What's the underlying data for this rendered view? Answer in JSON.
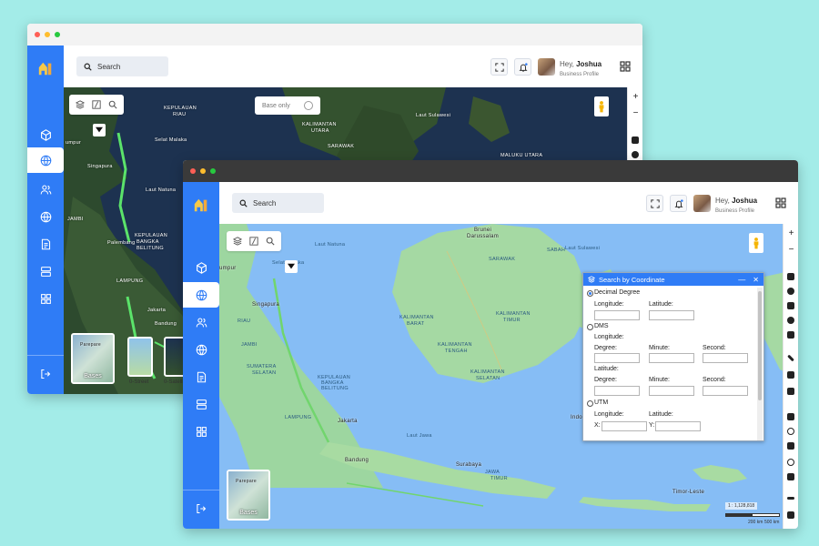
{
  "colors": {
    "background": "#a3ece8",
    "sidebar": "#2f7cf6",
    "accent": "#2f7cf6",
    "ocean_satellite": "#1d3250",
    "ocean_street": "#86bdf5",
    "land_street": "#9dd6a0"
  },
  "user": {
    "greeting": "Hey,",
    "name": "Joshua",
    "role": "Business Profile"
  },
  "search": {
    "placeholder": "Search"
  },
  "sidebar": {
    "items": [
      "cube-icon",
      "globe-icon",
      "users-icon",
      "globe-icon",
      "document-icon",
      "database-icon",
      "grid-icon"
    ],
    "active": "globe-icon",
    "logout": "logout-icon"
  },
  "back_window": {
    "base_only_label": "Base only",
    "basemaps": [
      {
        "label": "Bases",
        "selected": true
      },
      {
        "label": "0-Street"
      },
      {
        "label": "0-Satelli"
      }
    ],
    "thumb_city": "Parepare",
    "map_labels": {
      "city1": "umpur",
      "city2": "Singapura",
      "l1": "KEPULAUAN",
      "l2": "RIAU",
      "l3": "KALIMANTAN",
      "l4": "UTARA",
      "l5": "Laut Sulawesi",
      "l6": "Laut Natuna",
      "l7": "Palembang",
      "l8": "Jakarta",
      "l9": "Bandung",
      "l10": "LAMPUNG",
      "l11": "JAMBI",
      "l12": "KEPULAUAN",
      "l13": "BANGKA",
      "l14": "BELITUNG",
      "l15": "SARAWAK",
      "l16": "Selat Malaka",
      "l17": "MALUKU UTARA"
    }
  },
  "front_window": {
    "basemap_label": "Bases",
    "thumb_city": "Parepare",
    "map_labels": {
      "c1": "Brunei",
      "c2": "Darussalam",
      "c3": "umpur",
      "c4": "Singapura",
      "c5": "Jakarta",
      "c6": "Bandung",
      "c7": "Surabaya",
      "c8": "Timor-Leste",
      "c9": "Indo",
      "m1": "KALIMANTAN",
      "m2": "BARAT",
      "m3": "KALIMANTAN",
      "m4": "TENGAH",
      "m5": "KALIMANTAN",
      "m6": "SELATAN",
      "m7": "KALIMANTAN",
      "m8": "TIMUR",
      "m9": "KEPULAUAN",
      "m10": "BANGKA",
      "m11": "BELITUNG",
      "m12": "LAMPUNG",
      "m13": "Laut Jawa",
      "m14": "JAWA",
      "m15": "TIMUR",
      "m16": "Laut Sulawesi",
      "m17": "SARAWAK",
      "m18": "SABAH",
      "m19": "SUMATERA",
      "m20": "SELATAN",
      "m21": "JAMBI",
      "m22": "RIAU",
      "m23": "Selat Malaka",
      "m24": "Laut Natuna"
    },
    "scale": {
      "ratio": "1 : 1,128,818",
      "left": "200 km",
      "right": "500 km"
    }
  },
  "coord_panel": {
    "title": "Search by Coordinate",
    "dd": "Decimal Degree",
    "longitude": "Longitude:",
    "latitude": "Latitude:",
    "dms": "DMS",
    "degree": "Degree:",
    "minute": "Minute:",
    "second": "Second:",
    "utm": "UTM",
    "x": "X:",
    "y": "Y:"
  }
}
